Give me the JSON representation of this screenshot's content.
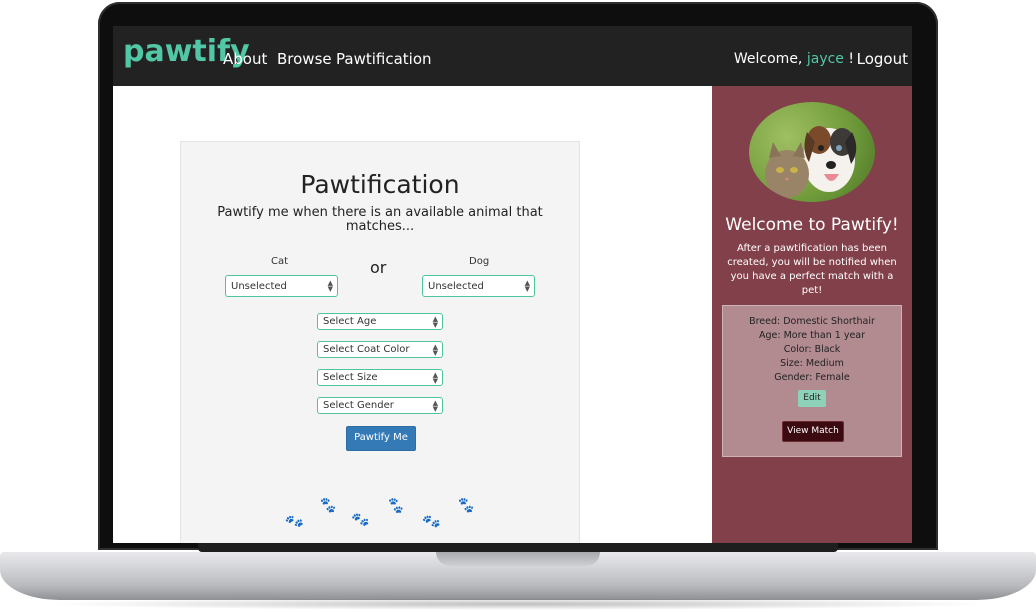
{
  "navbar": {
    "brand": "pawtify",
    "links": {
      "about": "About",
      "browse": "Browse",
      "pawtification": "Pawtification"
    },
    "welcome_prefix": "Welcome,",
    "username": "jayce",
    "welcome_suffix": "!",
    "logout": "Logout"
  },
  "form": {
    "title": "Pawtification",
    "subtitle": "Pawtify me when there is an available animal that matches...",
    "cat_label": "Cat",
    "dog_label": "Dog",
    "or_label": "or",
    "cat_select_value": "Unselected",
    "dog_select_value": "Unselected",
    "age_select": "Select Age",
    "coat_select": "Select Coat Color",
    "size_select": "Select Size",
    "gender_select": "Select Gender",
    "submit_label": "Pawtify Me"
  },
  "sidebar": {
    "title": "Welcome to Pawtify!",
    "description": "After a pawtification has been created, you will be notified when you have a perfect match with a pet!",
    "match": {
      "breed": "Breed: Domestic Shorthair",
      "age": "Age: More than 1 year",
      "color": "Color: Black",
      "size": "Size: Medium",
      "gender": "Gender: Female"
    },
    "edit_label": "Edit",
    "view_label": "View Match"
  },
  "colors": {
    "accent": "#52c7a5",
    "navbar": "#222222",
    "sidebar": "#82404a",
    "primary_button": "#337ab7"
  }
}
